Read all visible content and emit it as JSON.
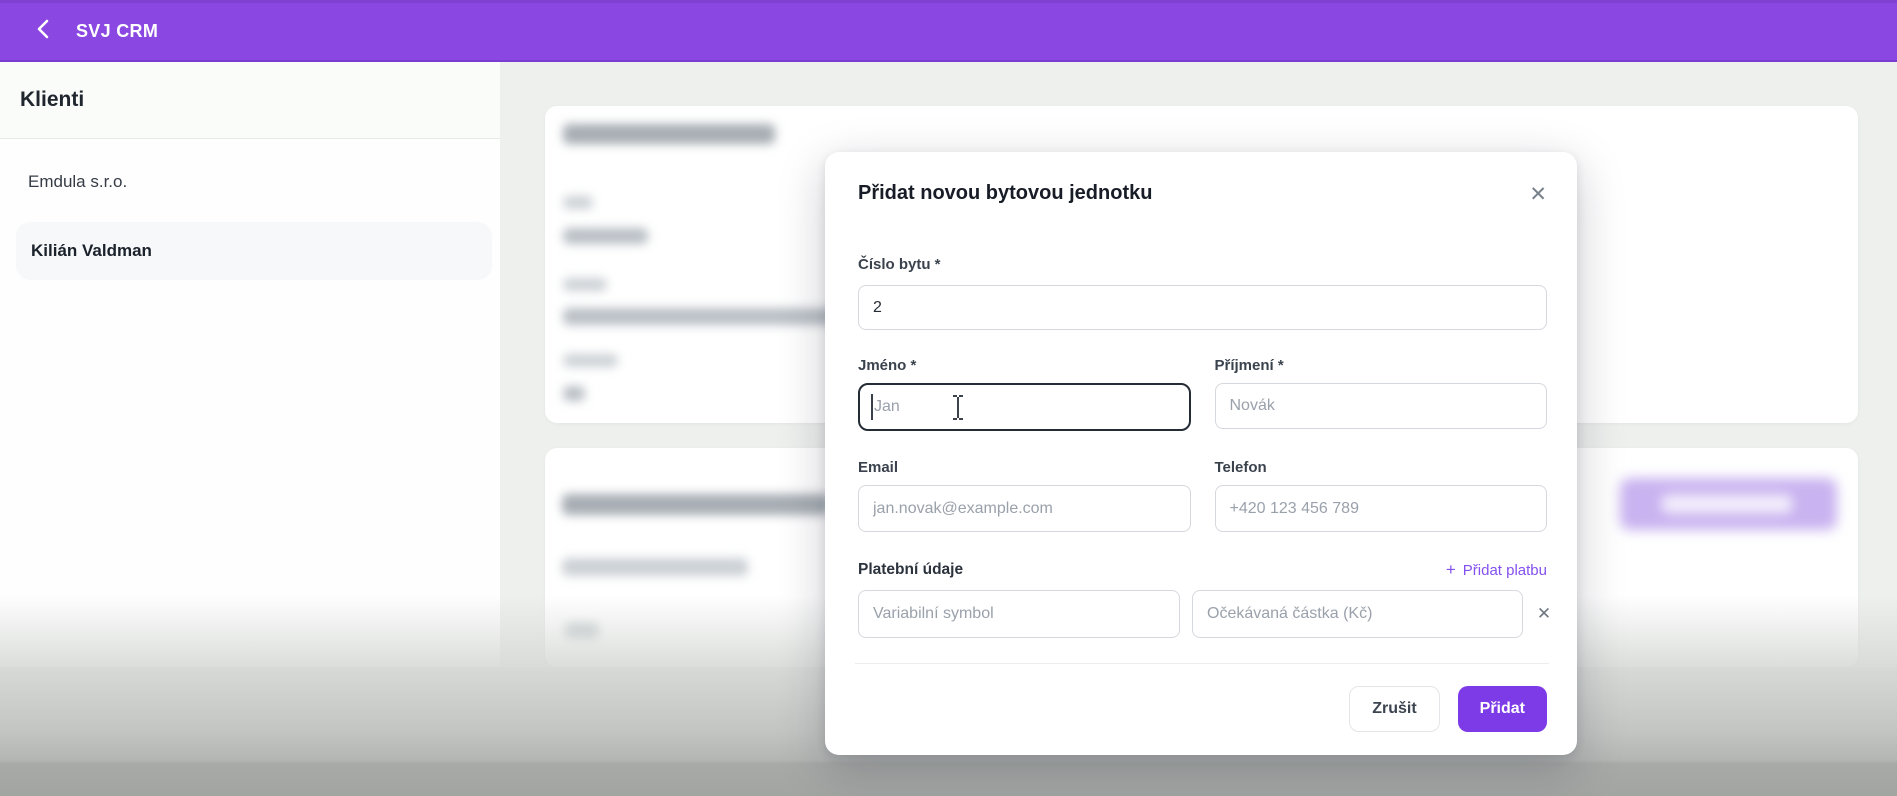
{
  "header": {
    "title": "SVJ CRM"
  },
  "sidebar": {
    "heading": "Klienti",
    "items": [
      {
        "label": "Emdula s.r.o.",
        "selected": false
      },
      {
        "label": "Kilián Valdman",
        "selected": true
      }
    ]
  },
  "modal": {
    "title": "Přidat novou bytovou jednotku",
    "close_icon": "✕",
    "fields": {
      "cislo_bytu": {
        "label": "Číslo bytu *",
        "value": "2"
      },
      "jmeno": {
        "label": "Jméno *",
        "placeholder": "Jan"
      },
      "prijmeni": {
        "label": "Příjmení *",
        "placeholder": "Novák"
      },
      "email": {
        "label": "Email",
        "placeholder": "jan.novak@example.com"
      },
      "telefon": {
        "label": "Telefon",
        "placeholder": "+420 123 456 789"
      }
    },
    "payment": {
      "label": "Platební údaje",
      "add_icon": "+",
      "add_label": "Přidat platbu",
      "variabilni_symbol_placeholder": "Variabilní symbol",
      "ocekavana_castka_placeholder": "Očekávaná částka (Kč)",
      "remove_icon": "✕"
    },
    "buttons": {
      "cancel": "Zrušit",
      "submit": "Přidat"
    }
  },
  "colors": {
    "header_purple": "#8a47e1",
    "accent_purple": "#7d3be8",
    "link_purple": "#8450ef",
    "content_bg": "#edf0ed"
  }
}
